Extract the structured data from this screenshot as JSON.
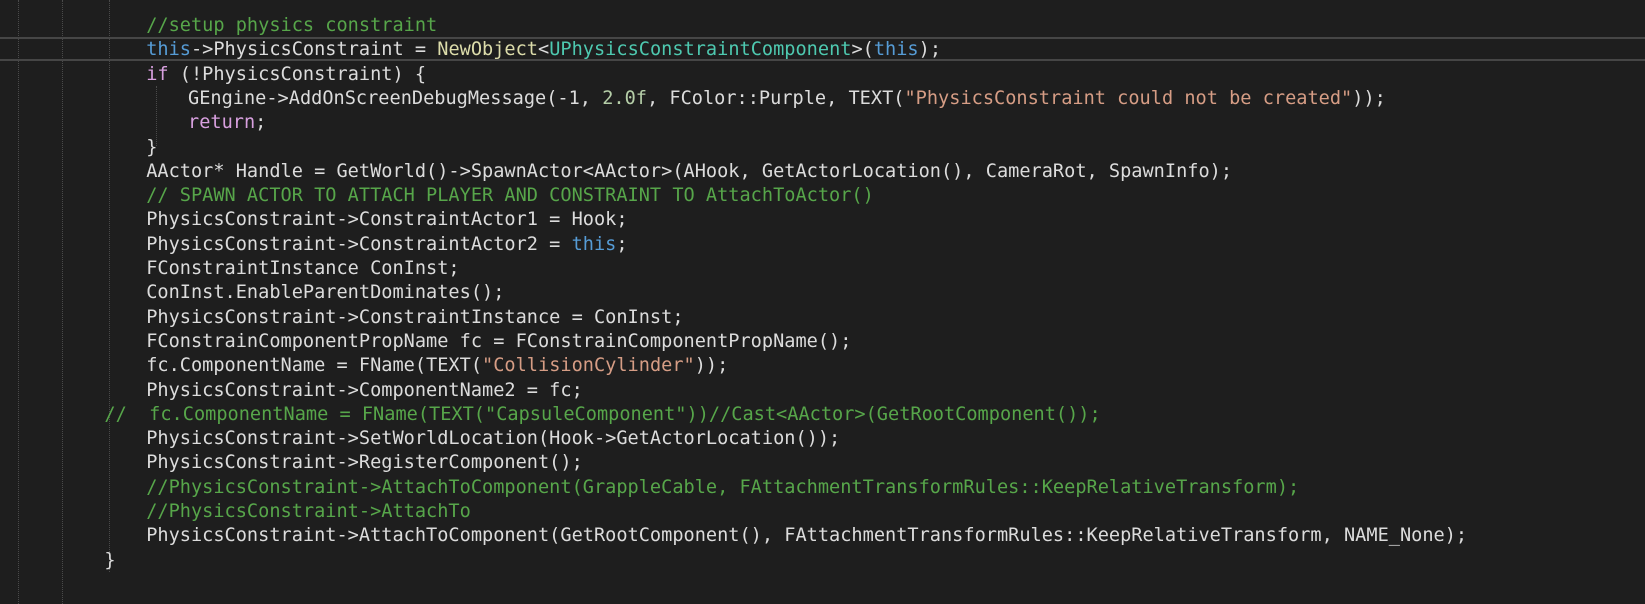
{
  "editor": {
    "language": "C++",
    "colors": {
      "background": "#1e1e1e",
      "comment": "#57a64a",
      "keyword": "#569cd6",
      "control": "#d8a0df",
      "type": "#4ec9b0",
      "function": "#dcdcaa",
      "string": "#d69d85",
      "number": "#b5cea8",
      "plain": "#dcdcdc"
    },
    "current_line_index": 1,
    "lines": [
      {
        "indent": 4,
        "tokens": [
          {
            "t": "//setup physics constraint",
            "c": "comment"
          }
        ]
      },
      {
        "indent": 4,
        "tokens": [
          {
            "t": "this",
            "c": "keyword"
          },
          {
            "t": "->PhysicsConstraint = ",
            "c": "plain"
          },
          {
            "t": "NewObject",
            "c": "func"
          },
          {
            "t": "<",
            "c": "plain"
          },
          {
            "t": "UPhysicsConstraintComponent",
            "c": "type"
          },
          {
            "t": ">(",
            "c": "plain"
          },
          {
            "t": "this",
            "c": "keyword"
          },
          {
            "t": ");",
            "c": "plain"
          }
        ]
      },
      {
        "indent": 4,
        "tokens": [
          {
            "t": "if",
            "c": "control"
          },
          {
            "t": " (!PhysicsConstraint) {",
            "c": "plain"
          }
        ]
      },
      {
        "indent": 5,
        "tokens": [
          {
            "t": "GEngine->AddOnScreenDebugMessage(-1, ",
            "c": "plain"
          },
          {
            "t": "2.0f",
            "c": "number"
          },
          {
            "t": ", FColor::Purple, TEXT(",
            "c": "plain"
          },
          {
            "t": "\"PhysicsConstraint could not be created\"",
            "c": "string"
          },
          {
            "t": "));",
            "c": "plain"
          }
        ]
      },
      {
        "indent": 5,
        "tokens": [
          {
            "t": "return",
            "c": "control"
          },
          {
            "t": ";",
            "c": "plain"
          }
        ]
      },
      {
        "indent": 4,
        "tokens": [
          {
            "t": "}",
            "c": "plain"
          }
        ]
      },
      {
        "indent": 4,
        "tokens": [
          {
            "t": "AActor* Handle = GetWorld()->SpawnActor<AActor>(AHook, GetActorLocation(), CameraRot, SpawnInfo);",
            "c": "plain"
          }
        ]
      },
      {
        "indent": 4,
        "tokens": [
          {
            "t": "// SPAWN ACTOR TO ATTACH PLAYER AND CONSTRAINT TO AttachToActor()",
            "c": "comment"
          }
        ]
      },
      {
        "indent": 4,
        "tokens": [
          {
            "t": "PhysicsConstraint->ConstraintActor1 = Hook;",
            "c": "plain"
          }
        ]
      },
      {
        "indent": 4,
        "tokens": [
          {
            "t": "PhysicsConstraint->ConstraintActor2 = ",
            "c": "plain"
          },
          {
            "t": "this",
            "c": "keyword"
          },
          {
            "t": ";",
            "c": "plain"
          }
        ]
      },
      {
        "indent": 4,
        "tokens": [
          {
            "t": "FConstraintInstance ConInst;",
            "c": "plain"
          }
        ]
      },
      {
        "indent": 4,
        "tokens": [
          {
            "t": "ConInst.EnableParentDominates();",
            "c": "plain"
          }
        ]
      },
      {
        "indent": 4,
        "tokens": [
          {
            "t": "PhysicsConstraint->ConstraintInstance = ConInst;",
            "c": "plain"
          }
        ]
      },
      {
        "indent": 4,
        "tokens": [
          {
            "t": "FConstrainComponentPropName fc = FConstrainComponentPropName();",
            "c": "plain"
          }
        ]
      },
      {
        "indent": 4,
        "tokens": [
          {
            "t": "fc.ComponentName = FName(TEXT(",
            "c": "plain"
          },
          {
            "t": "\"CollisionCylinder\"",
            "c": "string"
          },
          {
            "t": "));",
            "c": "plain"
          }
        ]
      },
      {
        "indent": 4,
        "tokens": [
          {
            "t": "PhysicsConstraint->ComponentName2 = fc;",
            "c": "plain"
          }
        ]
      },
      {
        "indent": 3,
        "tokens": [
          {
            "t": "//  fc.ComponentName = FName(TEXT(\"CapsuleComponent\"))//Cast<AActor>(GetRootComponent());",
            "c": "comment"
          }
        ]
      },
      {
        "indent": 4,
        "tokens": [
          {
            "t": "PhysicsConstraint->SetWorldLocation(Hook->GetActorLocation());",
            "c": "plain"
          }
        ]
      },
      {
        "indent": 4,
        "tokens": [
          {
            "t": "PhysicsConstraint->RegisterComponent();",
            "c": "plain"
          }
        ]
      },
      {
        "indent": 4,
        "tokens": [
          {
            "t": "//PhysicsConstraint->AttachToComponent(GrappleCable, FAttachmentTransformRules::KeepRelativeTransform);",
            "c": "comment"
          }
        ]
      },
      {
        "indent": 4,
        "tokens": [
          {
            "t": "//PhysicsConstraint->AttachTo",
            "c": "comment"
          }
        ]
      },
      {
        "indent": 4,
        "tokens": [
          {
            "t": "PhysicsConstraint->AttachToComponent(GetRootComponent(), FAttachmentTransformRules::KeepRelativeTransform, NAME_None);",
            "c": "plain"
          }
        ]
      },
      {
        "indent": 3,
        "tokens": [
          {
            "t": "}",
            "c": "plain"
          }
        ]
      }
    ]
  }
}
